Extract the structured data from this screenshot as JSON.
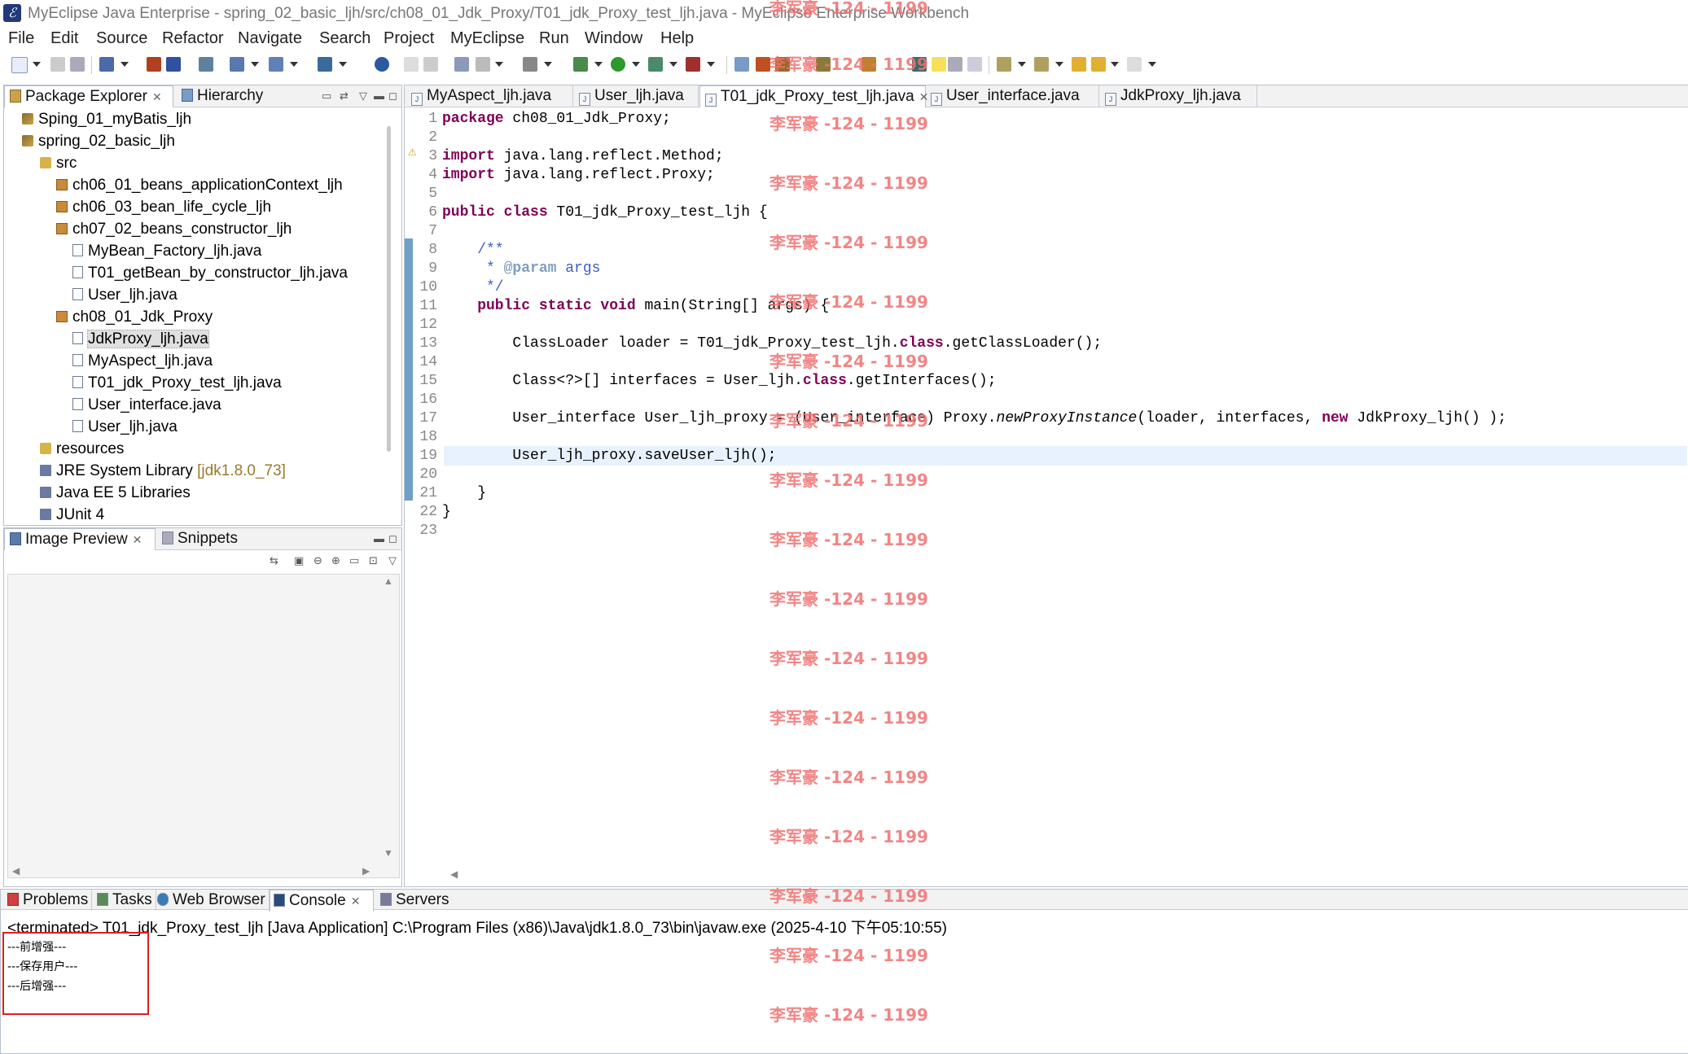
{
  "window": {
    "title": "MyEclipse Java Enterprise - spring_02_basic_ljh/src/ch08_01_Jdk_Proxy/T01_jdk_Proxy_test_ljh.java - MyEclipse Enterprise Workbench"
  },
  "menu": [
    "File",
    "Edit",
    "Source",
    "Refactor",
    "Navigate",
    "Search",
    "Project",
    "MyEclipse",
    "Run",
    "Window",
    "Help"
  ],
  "explorer": {
    "tabs": [
      "Package Explorer",
      "Hierarchy"
    ],
    "items": [
      {
        "label": "Sping_01_myBatis_ljh",
        "icon": "project-icon"
      },
      {
        "label": "spring_02_basic_ljh",
        "icon": "project-icon"
      },
      {
        "label": "src",
        "icon": "source-folder-icon"
      },
      {
        "label": "ch06_01_beans_applicationContext_ljh",
        "icon": "package-icon"
      },
      {
        "label": "ch06_03_bean_life_cycle_ljh",
        "icon": "package-icon"
      },
      {
        "label": "ch07_02_beans_constructor_ljh",
        "icon": "package-icon"
      },
      {
        "label": "MyBean_Factory_ljh.java",
        "icon": "java-file-icon"
      },
      {
        "label": "T01_getBean_by_constructor_ljh.java",
        "icon": "java-file-icon"
      },
      {
        "label": "User_ljh.java",
        "icon": "java-file-icon"
      },
      {
        "label": "ch08_01_Jdk_Proxy",
        "icon": "package-icon"
      },
      {
        "label": "JdkProxy_ljh.java",
        "icon": "java-file-icon"
      },
      {
        "label": "MyAspect_ljh.java",
        "icon": "java-file-icon"
      },
      {
        "label": "T01_jdk_Proxy_test_ljh.java",
        "icon": "java-file-icon"
      },
      {
        "label": "User_interface.java",
        "icon": "java-file-icon"
      },
      {
        "label": "User_ljh.java",
        "icon": "java-file-icon"
      },
      {
        "label": "resources",
        "icon": "folder-icon"
      },
      {
        "label": "JRE System Library",
        "suffix": "[jdk1.8.0_73]",
        "icon": "library-icon"
      },
      {
        "label": "Java EE 5 Libraries",
        "icon": "library-icon"
      },
      {
        "label": "JUnit 4",
        "icon": "library-icon"
      }
    ]
  },
  "preview": {
    "tabs": [
      "Image Preview",
      "Snippets"
    ]
  },
  "editor": {
    "tabs": [
      "MyAspect_ljh.java",
      "User_ljh.java",
      "T01_jdk_Proxy_test_ljh.java",
      "User_interface.java",
      "JdkProxy_ljh.java"
    ],
    "line_numbers": [
      "1",
      "2",
      "3",
      "4",
      "5",
      "6",
      "7",
      "8",
      "9",
      "10",
      "11",
      "12",
      "13",
      "14",
      "15",
      "16",
      "17",
      "18",
      "19",
      "20",
      "21",
      "22",
      "23"
    ],
    "lines": {
      "l1a": "package",
      "l1b": " ch08_01_Jdk_Proxy;",
      "l3a": "import",
      "l3b": " java.lang.reflect.Method;",
      "l4a": "import",
      "l4b": " java.lang.reflect.Proxy;",
      "l6a": "public class",
      "l6b": " T01_jdk_Proxy_test_ljh {",
      "l8": "    /**",
      "l9a": "     * ",
      "l9b": "@param",
      "l9c": " args",
      "l10": "     */",
      "l11a": "    public static void",
      "l11b": " main(String[] args) {",
      "l13a": "        ClassLoader loader = T01_jdk_Proxy_test_ljh.",
      "l13b": "class",
      "l13c": ".getClassLoader();",
      "l15a": "        Class<?>[] interfaces = User_ljh.",
      "l15b": "class",
      "l15c": ".getInterfaces();",
      "l17a": "        User_interface User_ljh_proxy = (User_interface) Proxy.",
      "l17b": "newProxyInstance",
      "l17c": "(loader, interfaces, ",
      "l17d": "new",
      "l17e": " JdkProxy_ljh() );",
      "l19": "        User_ljh_proxy.saveUser_ljh();",
      "l21": "    }",
      "l22": "}"
    }
  },
  "bottom": {
    "tabs": [
      "Problems",
      "Tasks",
      "Web Browser",
      "Console",
      "Servers"
    ],
    "console_header": "<terminated> T01_jdk_Proxy_test_ljh [Java Application] C:\\Program Files (x86)\\Java\\jdk1.8.0_73\\bin\\javaw.exe (2025-4-10 下午05:10:55)",
    "output": [
      "---前增强---",
      "---保存用户---",
      "---后增强---"
    ]
  },
  "watermark": "李军豪 -124 - 1199"
}
